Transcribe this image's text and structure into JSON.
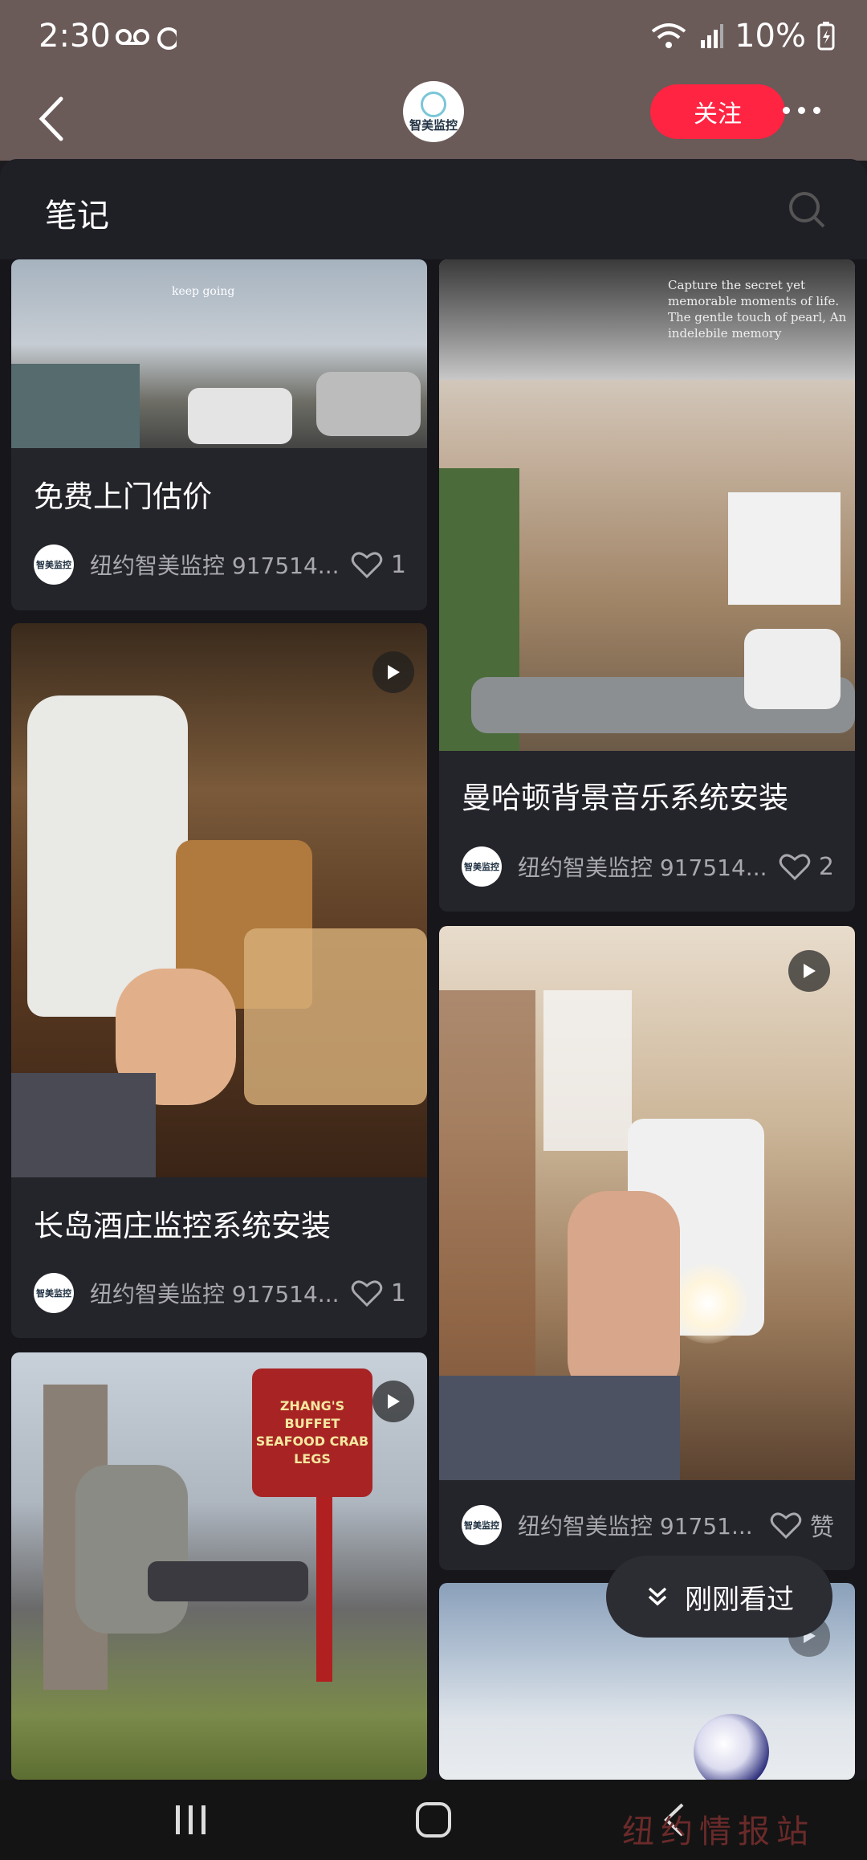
{
  "status": {
    "time": "2:30",
    "battery": "10%"
  },
  "header": {
    "account_name": "智美监控",
    "follow_label": "关注"
  },
  "sheet": {
    "title": "笔记"
  },
  "notes": [
    {
      "title": "免费上门估价",
      "author": "纽约智美监控 917514...",
      "likes": "1",
      "thumb_text": "keep going"
    },
    {
      "title": "曼哈顿背景音乐系统安装",
      "author": "纽约智美监控 917514...",
      "likes": "2",
      "thumb_text": "Capture the secret yet memorable moments of life. The gentle touch of pearl, An indelebile memory"
    },
    {
      "title": "长岛酒庄监控系统安装",
      "author": "纽约智美监控 917514...",
      "likes": "1"
    },
    {
      "title": "",
      "author": "纽约智美监控 91751...",
      "likes": "赞"
    },
    {
      "title": "",
      "author": "",
      "likes": "",
      "thumb_text": "ZHANG'S BUFFET SEAFOOD CRAB LEGS"
    },
    {
      "title": "",
      "author": "",
      "likes": ""
    }
  ],
  "avatar_text": "智美监控",
  "recent_label": "刚刚看过",
  "watermark": "纽约情报站"
}
